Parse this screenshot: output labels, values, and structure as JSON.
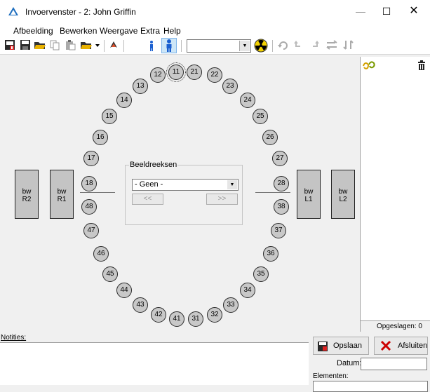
{
  "window": {
    "title": "Invoervenster - 2: John Griffin",
    "controls": {
      "minimize": "—",
      "maximize": "☐",
      "close": "✕"
    }
  },
  "menu": [
    "Afbeelding",
    "Bewerken",
    "Weergave",
    "Extra",
    "Help"
  ],
  "toolbar": {
    "combo_value": "",
    "icons": [
      "new-icon",
      "save-icon",
      "open-folder-icon",
      "copy-icon",
      "paste-icon",
      "open-dropdown-icon",
      "settings-icon",
      "person-small-icon",
      "person-large-icon",
      "radiation-icon",
      "rotate-icon",
      "undo-icon",
      "redo-icon",
      "flip-horizontal-icon",
      "flip-vertical-icon"
    ]
  },
  "teeth": [
    "11",
    "21",
    "12",
    "22",
    "13",
    "23",
    "14",
    "24",
    "15",
    "25",
    "16",
    "26",
    "17",
    "27",
    "18",
    "28",
    "48",
    "38",
    "47",
    "37",
    "46",
    "36",
    "45",
    "35",
    "44",
    "34",
    "43",
    "33",
    "42",
    "32",
    "41",
    "31"
  ],
  "selected_tooth": "11",
  "bitewings": {
    "r2": [
      "bw",
      "R2"
    ],
    "r1": [
      "bw",
      "R1"
    ],
    "l1": [
      "bw",
      "L1"
    ],
    "l2": [
      "bw",
      "L2"
    ]
  },
  "beeldreeksen": {
    "legend": "Beeldreeksen",
    "selected": "- Geen -",
    "prev": "<<",
    "next": ">>"
  },
  "right_panel": {
    "status": "Opgeslagen: 0"
  },
  "notes": {
    "label": "Notities:"
  },
  "actions": {
    "save": "Opslaan",
    "close": "Afsluiten"
  },
  "datum": {
    "label": "Datum:",
    "value": ""
  },
  "elementen": {
    "label": "Elementen:"
  }
}
